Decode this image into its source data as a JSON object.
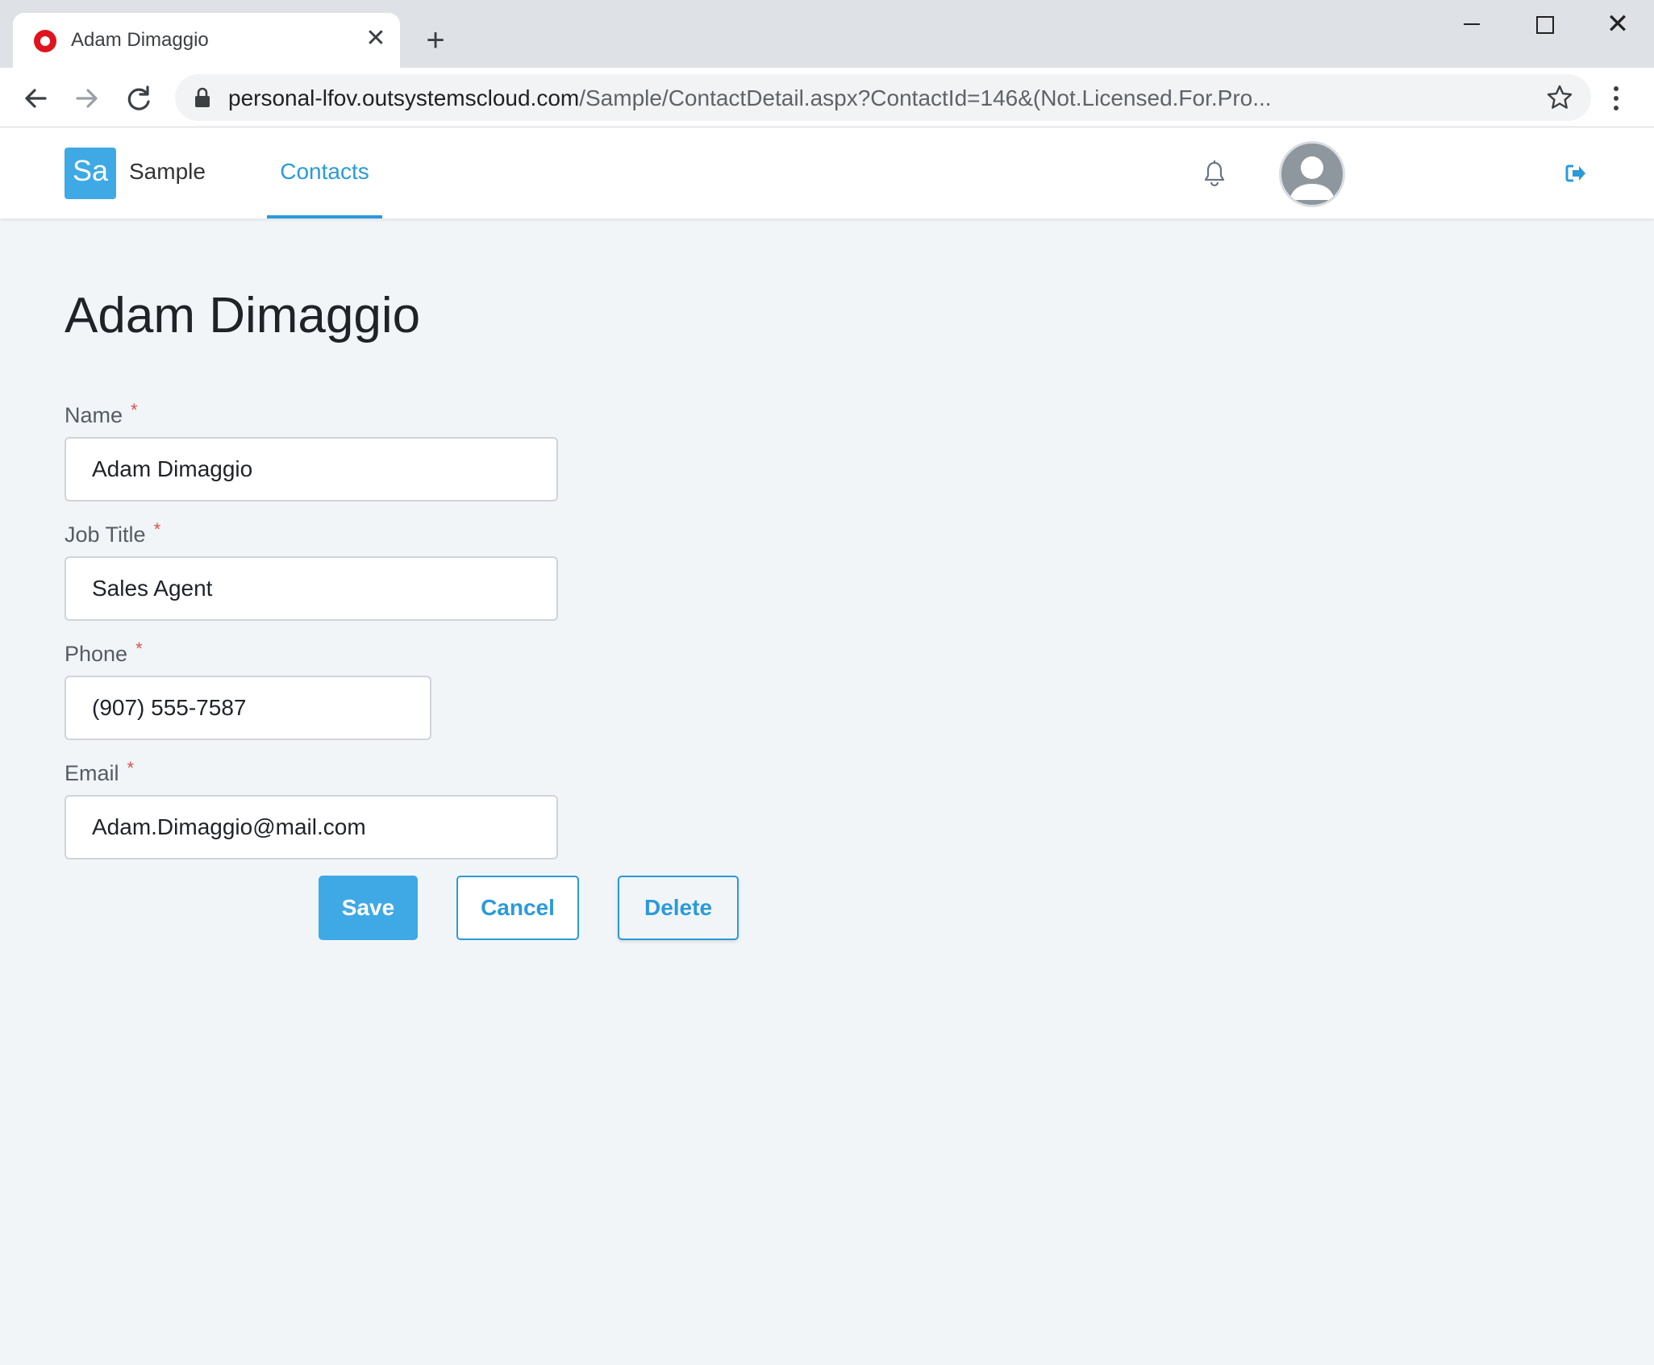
{
  "browser": {
    "tab_title": "Adam Dimaggio",
    "url_host": "personal-lfov.outsystemscloud.com",
    "url_path": "/Sample/ContactDetail.aspx?ContactId=146&(Not.Licensed.For.Pro..."
  },
  "app": {
    "logo_text": "Sa",
    "name": "Sample",
    "nav_item": "Contacts"
  },
  "page": {
    "title": "Adam Dimaggio"
  },
  "form": {
    "name": {
      "label": "Name",
      "required": "*",
      "value": "Adam Dimaggio"
    },
    "job_title": {
      "label": "Job Title",
      "required": "*",
      "value": "Sales Agent"
    },
    "phone": {
      "label": "Phone",
      "required": "*",
      "value": "(907) 555-7587"
    },
    "email": {
      "label": "Email",
      "required": "*",
      "value": "Adam.Dimaggio@mail.com"
    }
  },
  "actions": {
    "save": "Save",
    "cancel": "Cancel",
    "delete": "Delete"
  },
  "colors": {
    "accent": "#2b9ad9",
    "primary_button": "#3fa9e5",
    "page_background": "#f2f5f8",
    "required_marker": "#d9534f"
  }
}
